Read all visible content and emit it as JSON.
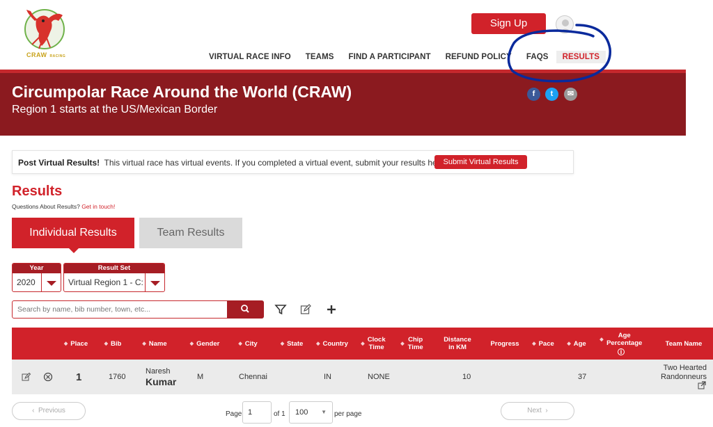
{
  "brand": {
    "logo_text": "CRAW",
    "logo_sub": "RACING"
  },
  "header": {
    "signup_label": "Sign Up"
  },
  "nav": {
    "items": [
      "VIRTUAL RACE INFO",
      "TEAMS",
      "FIND A PARTICIPANT",
      "REFUND POLICY",
      "FAQS",
      "RESULTS"
    ],
    "active": "RESULTS"
  },
  "banner": {
    "title": "Circumpolar Race Around the World (CRAW)",
    "subtitle": "Region 1 starts at the US/Mexican Border",
    "social": [
      "f",
      "t",
      "✉"
    ]
  },
  "post": {
    "bold": "Post Virtual Results!",
    "text": "This virtual race has virtual events. If you completed a virtual event, submit your results here.",
    "button": "Submit Virtual Results"
  },
  "results": {
    "heading": "Results",
    "question": "Questions About Results?",
    "contact_link": "Get in touch!"
  },
  "tabs": {
    "individual": "Individual Results",
    "team": "Team Results"
  },
  "filters": {
    "year_label": "Year",
    "year_value": "2020",
    "set_label": "Result Set",
    "set_value": "Virtual Region 1 - C:"
  },
  "search": {
    "placeholder": "Search by name, bib number, town, etc..."
  },
  "table": {
    "columns": [
      "Place",
      "Bib",
      "Name",
      "Gender",
      "City",
      "State",
      "Country",
      "Clock Time",
      "Chip Time",
      "Distance in KM",
      "Progress",
      "Pace",
      "Age",
      "Age Percentage",
      "Team Name"
    ],
    "rows": [
      {
        "place": "1",
        "bib": "1760",
        "first_name": "Naresh",
        "last_name": "Kumar",
        "gender": "M",
        "city": "Chennai",
        "state": "",
        "country": "IN",
        "clock_time": "NONE",
        "chip_time": "",
        "distance": "10",
        "progress": "",
        "pace": "",
        "age": "37",
        "age_percentage": "",
        "team_line1": "Two Hearted",
        "team_line2": "Randonneurs"
      }
    ]
  },
  "pagination": {
    "previous": "Previous",
    "next": "Next",
    "page_label": "Page",
    "page_value": "1",
    "of_label": "of 1",
    "per_page_value": "100",
    "per_page_label": "per page"
  },
  "colors": {
    "accent": "#d1222a",
    "banner": "#8b1a1f",
    "annotation": "#0a2a9c"
  }
}
